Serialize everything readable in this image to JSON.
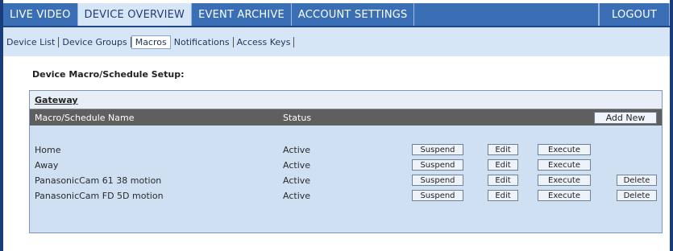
{
  "topnav": {
    "tabs": [
      "LIVE VIDEO",
      "DEVICE OVERVIEW",
      "EVENT ARCHIVE",
      "ACCOUNT SETTINGS"
    ],
    "active_tab": "DEVICE OVERVIEW",
    "logout": "LOGOUT"
  },
  "subnav": {
    "items": [
      "Device List",
      "Device Groups",
      "Macros",
      "Notifications",
      "Access Keys"
    ],
    "active": "Macros"
  },
  "page": {
    "title": "Device Macro/Schedule Setup:"
  },
  "gateway": {
    "label": "Gateway"
  },
  "table": {
    "col_name": "Macro/Schedule Name",
    "col_status": "Status",
    "add_new": "Add New",
    "rows": [
      {
        "name": "Home",
        "status": "Active",
        "suspend": "Suspend",
        "edit": "Edit",
        "execute": "Execute",
        "delete": ""
      },
      {
        "name": "Away",
        "status": "Active",
        "suspend": "Suspend",
        "edit": "Edit",
        "execute": "Execute",
        "delete": ""
      },
      {
        "name": "PanasonicCam 61 38 motion",
        "status": "Active",
        "suspend": "Suspend",
        "edit": "Edit",
        "execute": "Execute",
        "delete": "Delete"
      },
      {
        "name": "PanasonicCam FD 5D motion",
        "status": "Active",
        "suspend": "Suspend",
        "edit": "Edit",
        "execute": "Execute",
        "delete": "Delete"
      }
    ]
  },
  "colors": {
    "nav_bg": "#3a6fb5",
    "subnav_bg": "#d7e6f7",
    "panel_bg": "#cfe0f3",
    "header_bg": "#5f5f5f",
    "frame": "#1a3c7a"
  }
}
